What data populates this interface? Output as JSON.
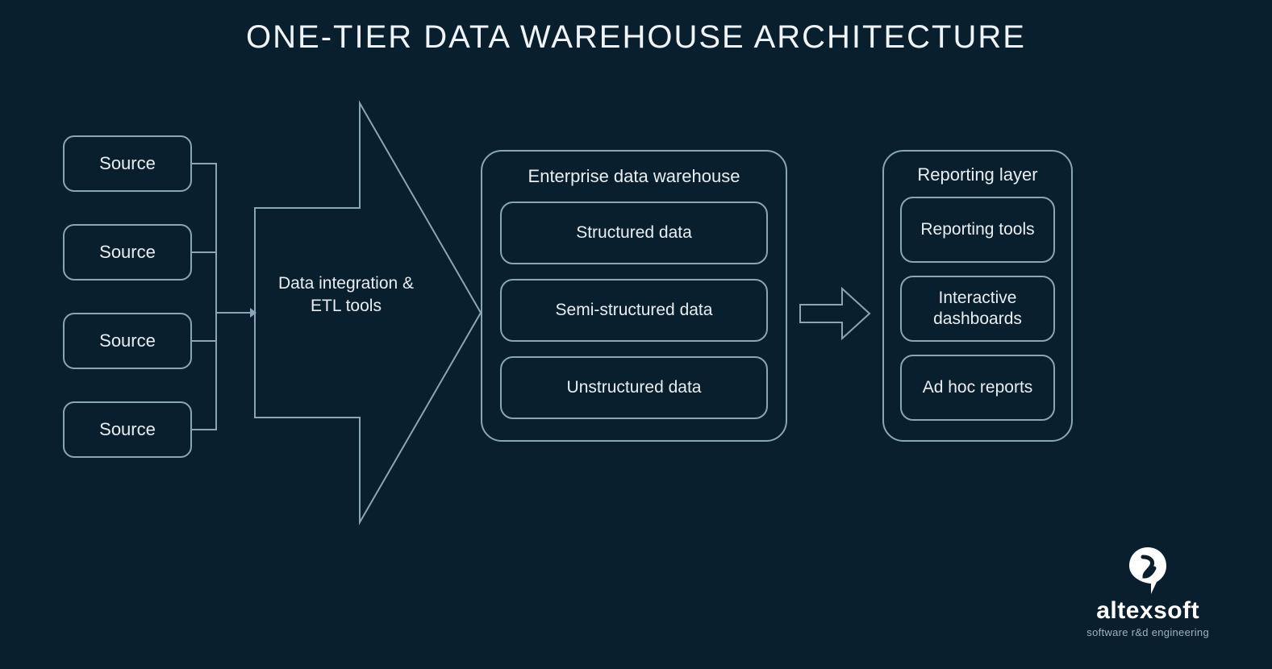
{
  "title": "ONE-TIER DATA WAREHOUSE ARCHITECTURE",
  "sources": [
    {
      "label": "Source"
    },
    {
      "label": "Source"
    },
    {
      "label": "Source"
    },
    {
      "label": "Source"
    }
  ],
  "etl": {
    "label": "Data integration & ETL tools"
  },
  "edw": {
    "title": "Enterprise data warehouse",
    "items": [
      {
        "label": "Structured data"
      },
      {
        "label": "Semi-structured data"
      },
      {
        "label": "Unstructured data"
      }
    ]
  },
  "reporting": {
    "title": "Reporting layer",
    "items": [
      {
        "label": "Reporting tools"
      },
      {
        "label": "Interactive dashboards"
      },
      {
        "label": "Ad hoc reports"
      }
    ]
  },
  "brand": {
    "name": "altexsoft",
    "tagline": "software r&d engineering"
  },
  "colors": {
    "background": "#0a1f2e",
    "stroke": "#88a6b5",
    "text": "#e8eef2",
    "brand_white": "#ffffff"
  }
}
